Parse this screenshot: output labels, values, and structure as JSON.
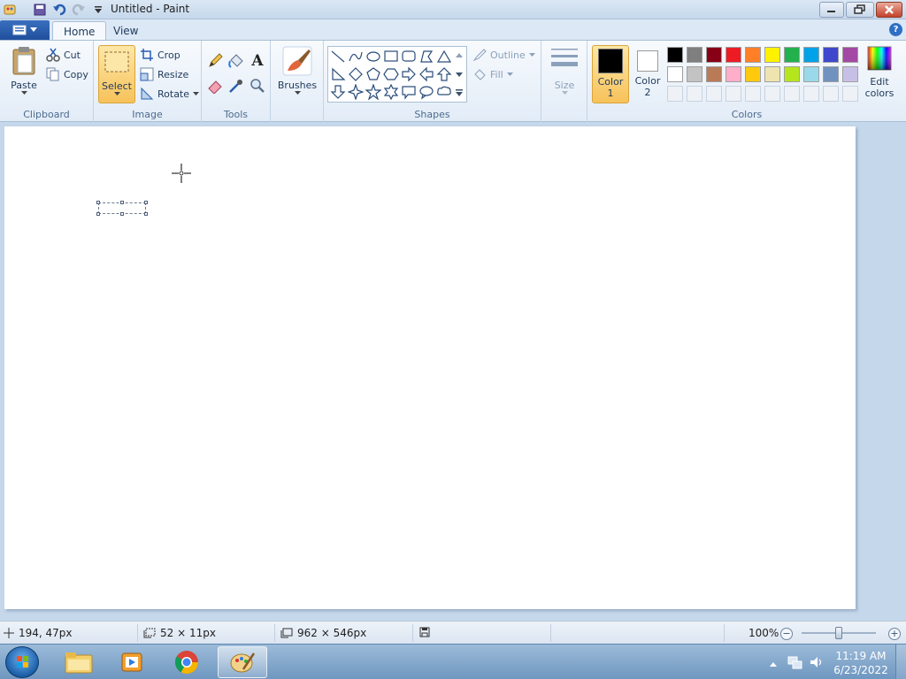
{
  "window": {
    "title": "Untitled - Paint"
  },
  "tabs": [
    {
      "label": "Home"
    },
    {
      "label": "View"
    }
  ],
  "ribbon": {
    "clipboard": {
      "group_label": "Clipboard",
      "paste": "Paste",
      "cut": "Cut",
      "copy": "Copy"
    },
    "image": {
      "group_label": "Image",
      "select": "Select",
      "crop": "Crop",
      "resize": "Resize",
      "rotate": "Rotate"
    },
    "tools": {
      "group_label": "Tools"
    },
    "brushes": {
      "label": "Brushes"
    },
    "shapes": {
      "group_label": "Shapes",
      "outline": "Outline",
      "fill": "Fill"
    },
    "size": {
      "label": "Size"
    },
    "colors": {
      "group_label": "Colors",
      "color1": {
        "label1": "Color",
        "label2": "1",
        "value": "#000000"
      },
      "color2": {
        "label1": "Color",
        "label2": "2",
        "value": "#ffffff"
      },
      "edit": {
        "label1": "Edit",
        "label2": "colors"
      },
      "palette_row1": [
        "#000000",
        "#7f7f7f",
        "#880015",
        "#ed1c24",
        "#ff7f27",
        "#fff200",
        "#22b14c",
        "#00a2e8",
        "#3f48cc",
        "#a349a4"
      ],
      "palette_row2": [
        "#ffffff",
        "#c3c3c3",
        "#b97a57",
        "#ffaec9",
        "#ffc90e",
        "#efe4b0",
        "#b5e61d",
        "#99d9ea",
        "#7092be",
        "#c8bfe7"
      ]
    }
  },
  "status": {
    "cursor_position": "194, 47px",
    "selection_size": "52 × 11px",
    "canvas_size": "962 × 546px",
    "zoom": "100%",
    "zoom_level": 0.5
  },
  "taskbar": {
    "time": "11:19 AM",
    "date": "6/23/2022"
  }
}
